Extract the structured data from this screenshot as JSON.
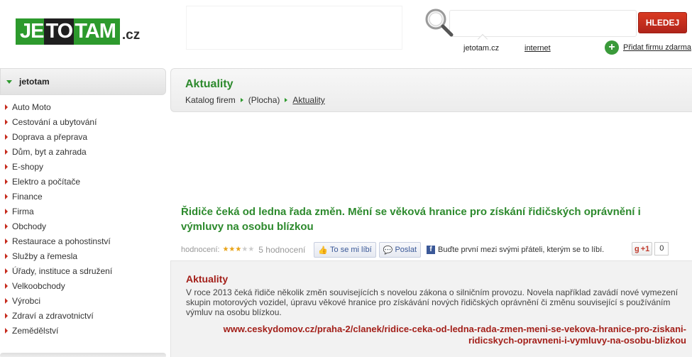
{
  "header": {
    "logo": {
      "part1": "JE",
      "part2": "TO",
      "part3": "TAM",
      "suffix": ".cz"
    },
    "search": {
      "placeholder": "",
      "button_label": "HLEDEJ"
    },
    "scopes": {
      "active": "jetotam.cz",
      "other": "internet"
    },
    "add_firm": {
      "icon": "plus-icon",
      "label": "Přidat firmu zdarma"
    }
  },
  "sidebar": {
    "title": "jetotam",
    "items": [
      {
        "label": "Auto Moto"
      },
      {
        "label": "Cestování a ubytování"
      },
      {
        "label": "Doprava a přeprava"
      },
      {
        "label": "Dům, byt a zahrada"
      },
      {
        "label": "E-shopy"
      },
      {
        "label": "Elektro a počítače"
      },
      {
        "label": "Finance"
      },
      {
        "label": "Firma"
      },
      {
        "label": "Obchody"
      },
      {
        "label": "Restaurace a pohostinství"
      },
      {
        "label": "Služby a řemesla"
      },
      {
        "label": "Úřady, instituce a sdružení"
      },
      {
        "label": "Velkoobchody"
      },
      {
        "label": "Výrobci"
      },
      {
        "label": "Zdraví a zdravotnictví"
      },
      {
        "label": "Zemědělství"
      }
    ]
  },
  "main": {
    "page_title": "Aktuality",
    "breadcrumb": [
      "Katalog firem",
      "(Plocha)",
      "Aktuality"
    ],
    "article": {
      "title": "Řidiče čeká od ledna řada změn. Mění se věková hranice pro získání řidičských oprávnění i výmluvy na osobu blízkou",
      "rating_label": "hodnocení:",
      "rating_value": 3,
      "rating_max": 5,
      "rating_count": "5 hodnocení",
      "like_label": "To se mi líbí",
      "send_label": "Poslat",
      "fb_text": "Buďte první mezi svými přáteli, kterým se to líbí.",
      "gplus_label": "+1",
      "gplus_count": "0"
    },
    "content": {
      "title": "Aktuality",
      "text": "V roce 2013 čeká řidiče několik změn souvisejících s novelou zákona o silničním provozu. Novela například zavádí nové vymezení skupin motorových vozidel, úpravu věkové hranice pro získávání nových řidičských oprávnění či změnu související s používáním výmluv na osobu blízkou.",
      "link": "www.ceskydomov.cz/praha-2/clanek/ridice-ceka-od-ledna-rada-zmen-meni-se-vekova-hranice-pro-ziskani-ridicskych-opravneni-i-vymluvy-na-osobu-blizkou"
    }
  },
  "colors": {
    "brand_green": "#2d9a2d",
    "accent_red": "#a3201a",
    "button_red": "#c0301d"
  }
}
